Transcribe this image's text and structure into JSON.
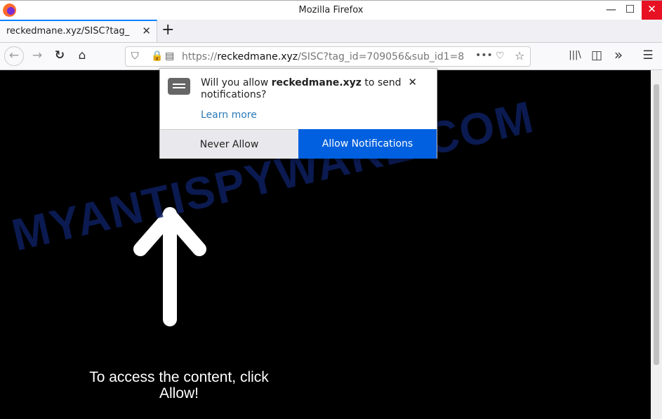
{
  "window": {
    "title": "Mozilla Firefox",
    "minimize": "—",
    "maximize": "☐",
    "close": "✕",
    "close_color": "#e81123"
  },
  "tab": {
    "label": "reckedmane.xyz/SISC?tag_",
    "close": "✕",
    "new_tab": "+"
  },
  "nav": {
    "back": "←",
    "forward": "→",
    "reload": "↻",
    "home": "⌂",
    "url_prefix": "https://",
    "url_domain": "reckedmane.xyz",
    "url_rest": "/SISC?tag_id=709056&sub_id1=8",
    "more": "•••",
    "library": "|||\\",
    "sidebar": "◫",
    "overflow": "»",
    "menu": "☰"
  },
  "popup": {
    "question_pre": "Will you allow ",
    "domain": "reckedmane.xyz",
    "question_post": " to send notifications?",
    "learn_more": "Learn more",
    "close": "✕",
    "never_allow": "Never Allow",
    "allow": "Allow Notifications",
    "allow_color": "#0060df"
  },
  "page": {
    "message": "To access the content, click Allow!",
    "arrow": "up-arrow"
  },
  "watermark": "MYANTISPYWARE.COM"
}
